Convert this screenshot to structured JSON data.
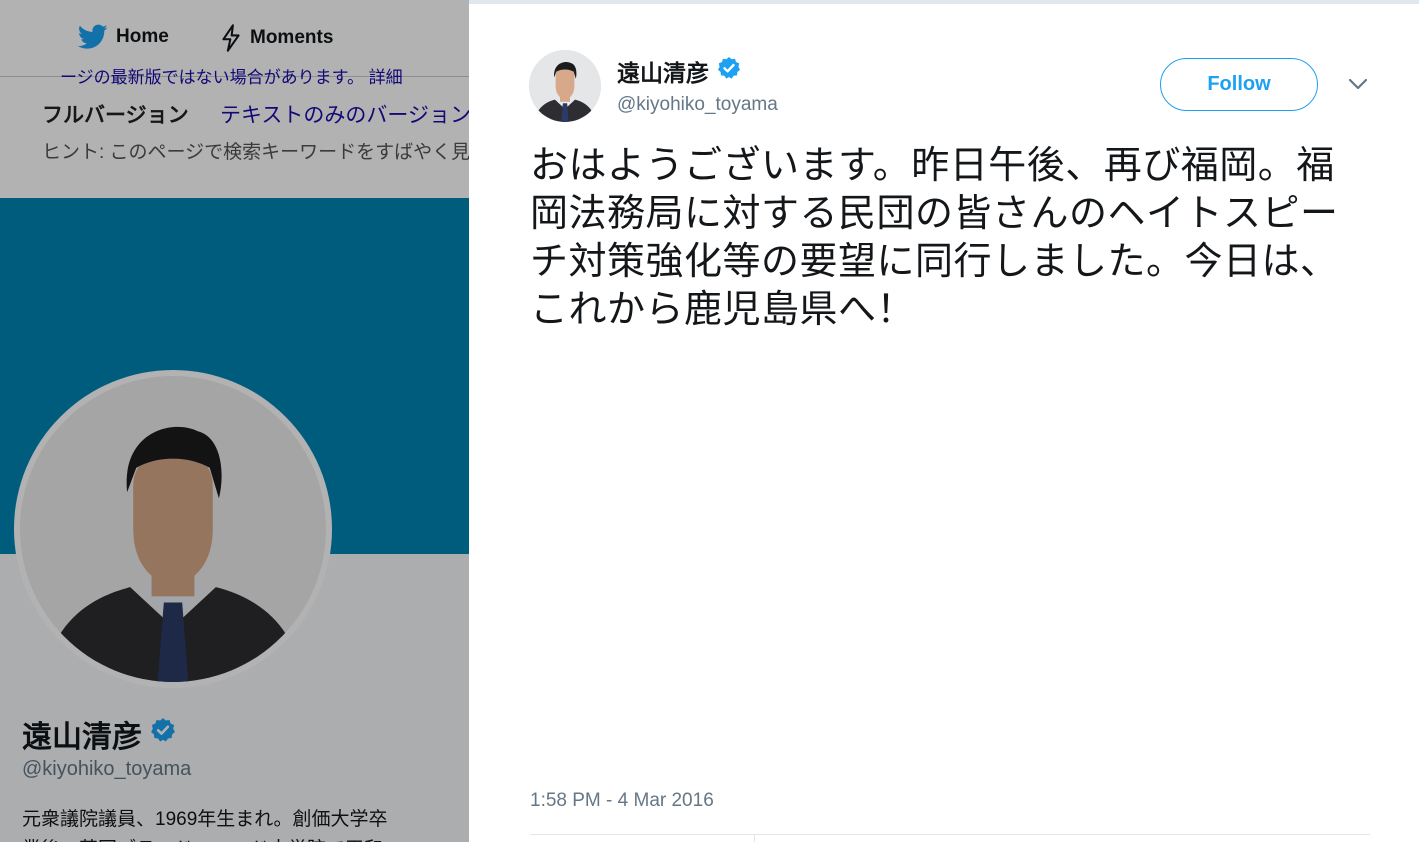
{
  "nav": {
    "home_label": "Home",
    "moments_label": "Moments"
  },
  "notice": {
    "cut_line": "ージの最新版ではない場合があります。 詳細",
    "full_version": "フルバージョン",
    "text_version": "テキストのみのバージョン",
    "hint": "ヒント: このページで検索キーワードをすばやく見"
  },
  "profile": {
    "name": "遠山清彦",
    "handle": "@kiyohiko_toyama",
    "bio_line1": "元衆議院議員、1969年生まれ。創価大学卒",
    "bio_line2": "業後、英国ブラッドフォード大学院で平和"
  },
  "tweet": {
    "author_name": "遠山清彦",
    "author_handle": "@kiyohiko_toyama",
    "verified": true,
    "follow_label": "Follow",
    "text": "おはようございます。昨日午後、再び福岡。福岡法務局に対する民団の皆さんのヘイトスピーチ対策強化等の要望に同行しました。今日は、これから鹿児島県へ！",
    "timestamp": "1:58 PM - 4 Mar 2016"
  },
  "colors": {
    "twitter_blue": "#1da1f2",
    "banner": "#0084b4",
    "text_primary": "#14171a",
    "text_secondary": "#657786"
  },
  "icons": {
    "home": "twitter-bird-icon",
    "moments": "lightning-icon",
    "verified": "verified-badge-icon",
    "caret": "chevron-down-icon"
  }
}
